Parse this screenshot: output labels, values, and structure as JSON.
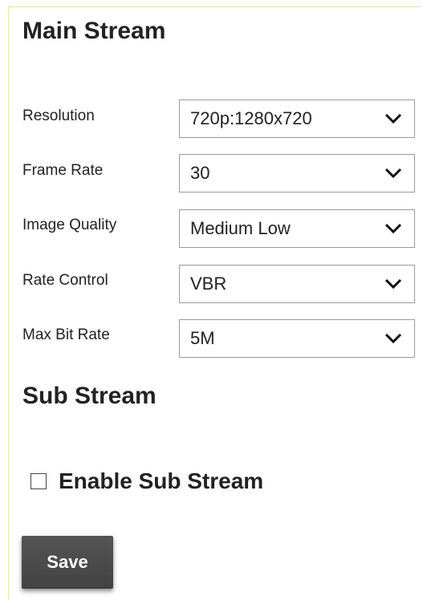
{
  "main_stream": {
    "title": "Main Stream",
    "fields": [
      {
        "label": "Resolution",
        "value": "720p:1280x720",
        "icon": "chevron-down-icon"
      },
      {
        "label": "Frame Rate",
        "value": "30",
        "icon": "chevron-down-icon"
      },
      {
        "label": "Image Quality",
        "value": "Medium Low",
        "icon": "chevron-down-icon"
      },
      {
        "label": "Rate Control",
        "value": "VBR",
        "icon": "chevron-down-icon"
      },
      {
        "label": "Max Bit Rate",
        "value": "5M",
        "icon": "chevron-down-icon"
      }
    ]
  },
  "sub_stream": {
    "title": "Sub Stream",
    "enable_label": "Enable Sub Stream",
    "enabled": false
  },
  "actions": {
    "save_label": "Save"
  },
  "colors": {
    "panel_border": "#e7e79a",
    "select_border": "#9a9a9a",
    "button_bg": "#4a4a4a",
    "text": "#222222"
  }
}
